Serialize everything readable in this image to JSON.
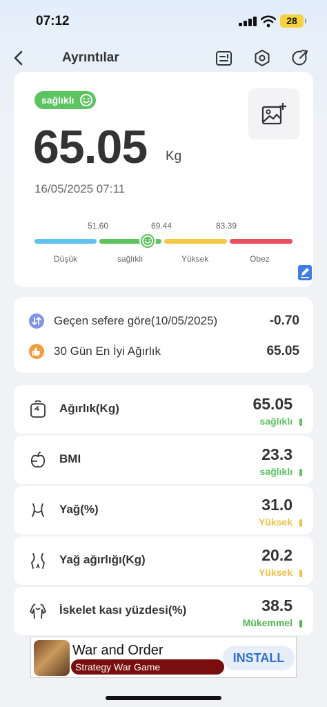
{
  "status_bar": {
    "time": "07:12",
    "battery": "28"
  },
  "header": {
    "title": "Ayrıntılar"
  },
  "summary": {
    "badge": "sağlıklı",
    "weight": "65.05",
    "unit": "Kg",
    "datetime": "16/05/2025 07:11",
    "thresholds": [
      "51.60",
      "69.44",
      "83.39"
    ],
    "categories": [
      "Düşük",
      "sağlıklı",
      "Yüksek",
      "Obez"
    ],
    "segment_colors": [
      "#5ec3ec",
      "#5cc45f",
      "#f3c844",
      "#e94f5e"
    ]
  },
  "comparison": [
    {
      "label": "Geçen sefere göre(10/05/2025)",
      "value": "-0.70",
      "icon": "compare-icon",
      "color": "#7f93e8"
    },
    {
      "label": "30 Gün En İyi Ağırlık",
      "value": "65.05",
      "icon": "thumbs-up-icon",
      "color": "#f59b3a"
    }
  ],
  "metrics": [
    {
      "label": "Ağırlık(Kg)",
      "value": "65.05",
      "status": "sağlıklı",
      "color": "#5cc45f",
      "icon": "scale-icon"
    },
    {
      "label": "BMI",
      "value": "23.3",
      "status": "sağlıklı",
      "color": "#5cc45f",
      "icon": "apple-icon"
    },
    {
      "label": "Yağ(%)",
      "value": "31.0",
      "status": "Yüksek",
      "color": "#f0c040",
      "icon": "waist-icon"
    },
    {
      "label": "Yağ ağırlığı(Kg)",
      "value": "20.2",
      "status": "Yüksek",
      "color": "#f0c040",
      "icon": "hip-icon"
    },
    {
      "label": "İskelet kası yüzdesi(%)",
      "value": "38.5",
      "status": "Mükemmel",
      "color": "#4cb84c",
      "icon": "muscle-icon"
    }
  ],
  "ad": {
    "title": "War and Order",
    "subtitle": "Strategy War Game",
    "cta": "INSTALL"
  }
}
